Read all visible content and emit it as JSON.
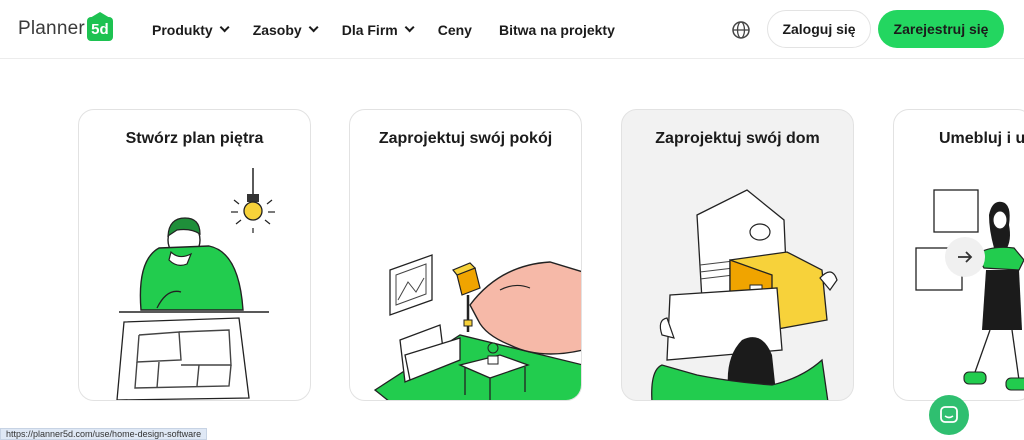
{
  "header": {
    "logo_text": "Planner",
    "logo_badge": "5d",
    "nav": [
      {
        "label": "Produkty",
        "has_dropdown": true
      },
      {
        "label": "Zasoby",
        "has_dropdown": true
      },
      {
        "label": "Dla Firm",
        "has_dropdown": true
      },
      {
        "label": "Ceny",
        "has_dropdown": false
      },
      {
        "label": "Bitwa na projekty",
        "has_dropdown": false
      }
    ],
    "language_icon": "globe-icon",
    "login_label": "Zaloguj się",
    "register_label": "Zarejestruj się"
  },
  "cards": [
    {
      "title": "Stwórz plan piętra"
    },
    {
      "title": "Zaprojektuj swój pokój"
    },
    {
      "title": "Zaprojektuj swój dom"
    },
    {
      "title": "Umebluj i u"
    }
  ],
  "carousel": {
    "next_icon": "arrow-right-icon"
  },
  "chat": {
    "icon": "chat-icon"
  },
  "status_bar": {
    "url": "https://planner5d.com/use/home-design-software"
  },
  "colors": {
    "brand_green": "#23d660",
    "logo_green": "#1dc251",
    "illustration_green": "#22cc4e",
    "bulb_yellow": "#f7d23a",
    "box_orange": "#f0a400"
  }
}
